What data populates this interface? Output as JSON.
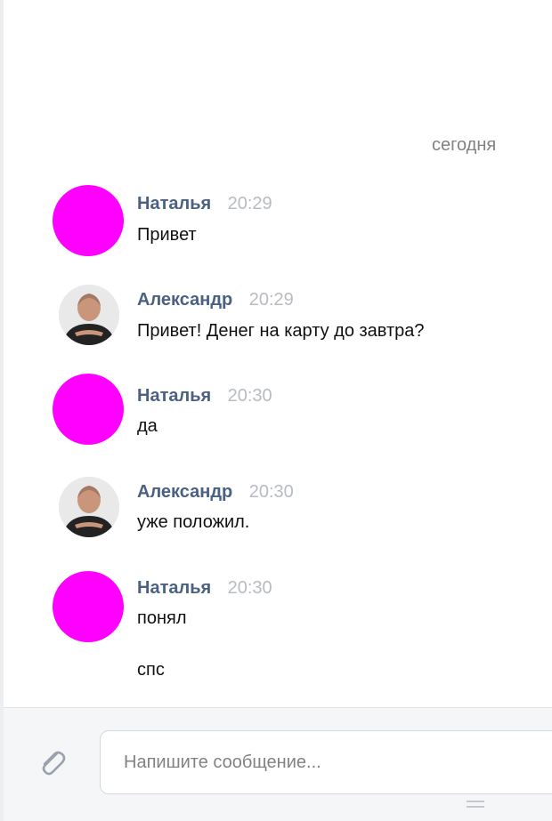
{
  "date_separator": "сегодня",
  "messages": [
    {
      "author": "Наталья",
      "time": "20:29",
      "lines": [
        "Привет"
      ]
    },
    {
      "author": "Александр",
      "time": "20:29",
      "lines": [
        "Привет! Денег на карту до завтра?"
      ]
    },
    {
      "author": "Наталья",
      "time": "20:30",
      "lines": [
        "да"
      ]
    },
    {
      "author": "Александр",
      "time": "20:30",
      "lines": [
        "уже положил."
      ]
    },
    {
      "author": "Наталья",
      "time": "20:30",
      "lines": [
        "понял",
        "спс"
      ]
    }
  ],
  "composer": {
    "placeholder": "Напишите сообщение..."
  },
  "colors": {
    "author": "#4a6183",
    "time": "#b8bcc2",
    "avatar_pink": "#ff00ff"
  },
  "icons": {
    "attach": "paperclip-icon"
  }
}
